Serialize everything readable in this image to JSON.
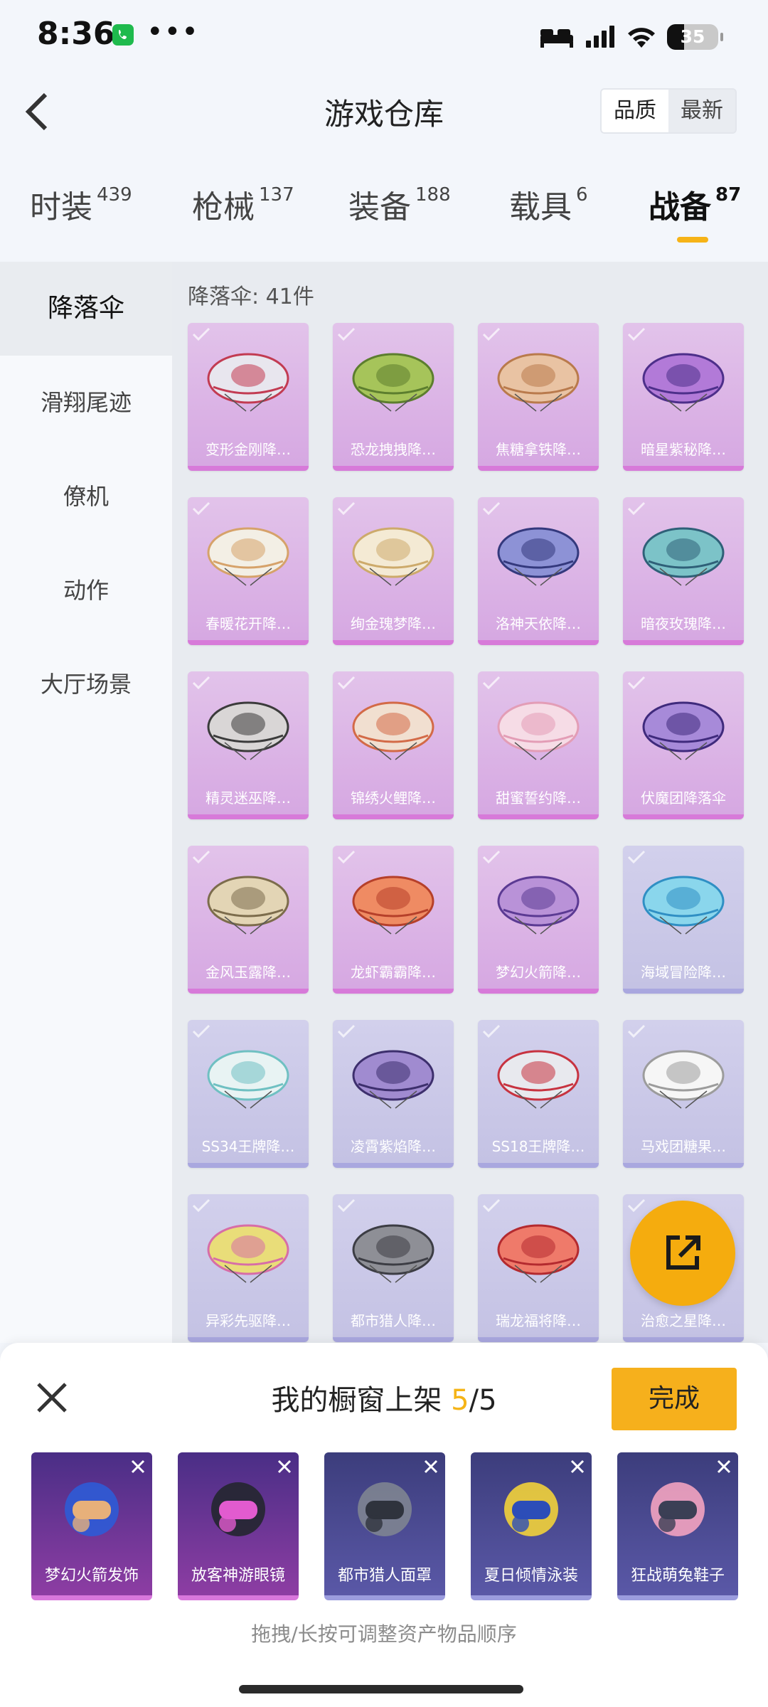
{
  "status_bar": {
    "time": "8:36",
    "battery": "35",
    "icons": [
      "call-icon",
      "more-icon",
      "bed-icon",
      "signal-icon",
      "wifi-icon",
      "battery-icon"
    ]
  },
  "header": {
    "title": "游戏仓库",
    "sort_quality": "品质",
    "sort_latest": "最新"
  },
  "tabs": [
    {
      "label": "时装",
      "count": "439"
    },
    {
      "label": "枪械",
      "count": "137"
    },
    {
      "label": "装备",
      "count": "188"
    },
    {
      "label": "载具",
      "count": "6"
    },
    {
      "label": "战备",
      "count": "87",
      "active": true
    }
  ],
  "sidebar": [
    {
      "label": "降落伞",
      "active": true
    },
    {
      "label": "滑翔尾迹"
    },
    {
      "label": "僚机"
    },
    {
      "label": "动作"
    },
    {
      "label": "大厅场景"
    }
  ],
  "content": {
    "section_title": "降落伞: 41件",
    "items": [
      {
        "name": "变形金刚降…",
        "rarity": "purple",
        "colors": [
          "#e8e6ee",
          "#c23b52"
        ]
      },
      {
        "name": "恐龙拽拽降…",
        "rarity": "purple",
        "colors": [
          "#a6c45a",
          "#5c7e2e"
        ]
      },
      {
        "name": "焦糖拿铁降…",
        "rarity": "purple",
        "colors": [
          "#e9c3a3",
          "#b97a4c"
        ]
      },
      {
        "name": "暗星紫秘降…",
        "rarity": "purple",
        "colors": [
          "#b27ad8",
          "#4d2f8a"
        ]
      },
      {
        "name": "春暖花开降…",
        "rarity": "purple",
        "colors": [
          "#f3efe5",
          "#d6a26a"
        ]
      },
      {
        "name": "绚金瑰梦降…",
        "rarity": "purple",
        "colors": [
          "#f4ead4",
          "#cdaa6b"
        ]
      },
      {
        "name": "洛神天依降…",
        "rarity": "purple",
        "colors": [
          "#8d92d6",
          "#34397d"
        ]
      },
      {
        "name": "暗夜玫瑰降…",
        "rarity": "purple",
        "colors": [
          "#7cc3c8",
          "#2f6078"
        ]
      },
      {
        "name": "精灵迷巫降…",
        "rarity": "purple",
        "colors": [
          "#d9d6d6",
          "#3b3b3b"
        ]
      },
      {
        "name": "锦绣火鲤降…",
        "rarity": "purple",
        "colors": [
          "#f1dfd0",
          "#d36a47"
        ]
      },
      {
        "name": "甜蜜誓约降…",
        "rarity": "purple",
        "colors": [
          "#f6dce6",
          "#e39db6"
        ]
      },
      {
        "name": "伏魔团降落伞",
        "rarity": "purple",
        "colors": [
          "#a78ad9",
          "#3f2a7c"
        ]
      },
      {
        "name": "金风玉露降…",
        "rarity": "purple",
        "colors": [
          "#e3d5b5",
          "#7c6c4c"
        ]
      },
      {
        "name": "龙虾霸霸降…",
        "rarity": "purple",
        "colors": [
          "#ef8b63",
          "#b6402a"
        ]
      },
      {
        "name": "梦幻火箭降…",
        "rarity": "purple",
        "colors": [
          "#b992d8",
          "#5b3a93"
        ]
      },
      {
        "name": "海域冒险降…",
        "rarity": "blue",
        "colors": [
          "#8ad6ec",
          "#2f8fc4"
        ]
      },
      {
        "name": "SS34王牌降…",
        "rarity": "blue",
        "colors": [
          "#e8f3f3",
          "#6fc0c2"
        ]
      },
      {
        "name": "凌霄紫焰降…",
        "rarity": "blue",
        "colors": [
          "#a08bd0",
          "#3d2f6d"
        ]
      },
      {
        "name": "SS18王牌降…",
        "rarity": "blue",
        "colors": [
          "#e8e9ee",
          "#c73340"
        ]
      },
      {
        "name": "马戏团糖果…",
        "rarity": "blue",
        "colors": [
          "#f6f6f6",
          "#9c9c9c"
        ]
      },
      {
        "name": "异彩先驱降…",
        "rarity": "blue",
        "colors": [
          "#e9dd79",
          "#d76da7"
        ]
      },
      {
        "name": "都市猎人降…",
        "rarity": "blue",
        "colors": [
          "#8e8f96",
          "#3c3d44"
        ]
      },
      {
        "name": "瑞龙福将降…",
        "rarity": "blue",
        "colors": [
          "#ef7a6a",
          "#b42a2f"
        ]
      },
      {
        "name": "治愈之星降…",
        "rarity": "blue",
        "colors": [
          "#e2ddec",
          "#9d92c7"
        ]
      }
    ]
  },
  "showcase": {
    "title_prefix": "我的橱窗上架 ",
    "count": "5",
    "total": "/5",
    "done_label": "完成",
    "hint": "拖拽/长按可调整资产物品顺序",
    "items": [
      {
        "name": "梦幻火箭发饰",
        "rarity": "purple",
        "colors": [
          "#2e5bd6",
          "#e7b07a"
        ]
      },
      {
        "name": "放客神游眼镜",
        "rarity": "purple",
        "colors": [
          "#24262f",
          "#e25bcf"
        ]
      },
      {
        "name": "都市猎人面罩",
        "rarity": "blue",
        "colors": [
          "#7e8491",
          "#2f333d"
        ]
      },
      {
        "name": "夏日倾情泳装",
        "rarity": "blue",
        "colors": [
          "#f2d23a",
          "#2c4db8"
        ]
      },
      {
        "name": "狂战萌兔鞋子",
        "rarity": "blue",
        "colors": [
          "#f3a3c0",
          "#3b3f55"
        ]
      }
    ]
  }
}
